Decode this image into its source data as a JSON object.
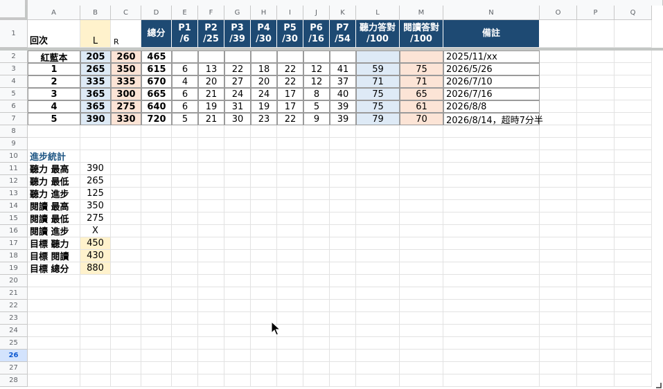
{
  "columns": [
    "A",
    "B",
    "C",
    "D",
    "E",
    "F",
    "G",
    "H",
    "I",
    "J",
    "K",
    "L",
    "M",
    "N",
    "O",
    "P",
    "Q"
  ],
  "rows": [
    "1",
    "2",
    "3",
    "4",
    "5",
    "6",
    "7",
    "8",
    "9",
    "10",
    "11",
    "12",
    "13",
    "14",
    "15",
    "16",
    "17",
    "18",
    "19",
    "20",
    "21",
    "22",
    "23",
    "24",
    "25",
    "26",
    "27",
    "28"
  ],
  "selected_row": "26",
  "header": {
    "round": "回次",
    "l": "L",
    "r": "R",
    "total": "總分",
    "parts": [
      "P1\n/6",
      "P2\n/25",
      "P3\n/39",
      "P4\n/30",
      "P5\n/30",
      "P6\n/16",
      "P7\n/54"
    ],
    "listening_correct": "聽力答對\n/100",
    "reading_correct": "閱讀答對\n/100",
    "notes": "備註"
  },
  "scores": [
    {
      "round": "紅藍本",
      "l": "205",
      "r": "260",
      "total": "465",
      "parts": [
        "",
        "",
        "",
        "",
        "",
        "",
        ""
      ],
      "lc": "",
      "rc": "",
      "note": "2025/11/xx"
    },
    {
      "round": "1",
      "l": "265",
      "r": "350",
      "total": "615",
      "parts": [
        "6",
        "13",
        "22",
        "18",
        "22",
        "12",
        "41"
      ],
      "lc": "59",
      "rc": "75",
      "note": "2026/5/26"
    },
    {
      "round": "2",
      "l": "335",
      "r": "335",
      "total": "670",
      "parts": [
        "4",
        "20",
        "27",
        "20",
        "22",
        "12",
        "37"
      ],
      "lc": "71",
      "rc": "71",
      "note": "2026/7/10"
    },
    {
      "round": "3",
      "l": "365",
      "r": "300",
      "total": "665",
      "parts": [
        "6",
        "21",
        "24",
        "24",
        "17",
        "8",
        "40"
      ],
      "lc": "75",
      "rc": "65",
      "note": "2026/7/16"
    },
    {
      "round": "4",
      "l": "365",
      "r": "275",
      "total": "640",
      "parts": [
        "6",
        "19",
        "31",
        "19",
        "17",
        "5",
        "39"
      ],
      "lc": "75",
      "rc": "61",
      "note": "2026/8/8"
    },
    {
      "round": "5",
      "l": "390",
      "r": "330",
      "total": "720",
      "parts": [
        "5",
        "21",
        "30",
        "23",
        "22",
        "9",
        "39"
      ],
      "lc": "79",
      "rc": "70",
      "note": "2026/8/14，超時7分半"
    }
  ],
  "progress": {
    "title": "進步統計",
    "items": [
      {
        "label": "聽力 最高",
        "value": "390",
        "target": false
      },
      {
        "label": "聽力 最低",
        "value": "265",
        "target": false
      },
      {
        "label": "聽力 進步",
        "value": "125",
        "target": false
      },
      {
        "label": "閱讀 最高",
        "value": "350",
        "target": false
      },
      {
        "label": "閱讀 最低",
        "value": "275",
        "target": false
      },
      {
        "label": "閱讀 進步",
        "value": "X",
        "target": false
      },
      {
        "label": "目標 聽力",
        "value": "450",
        "target": true
      },
      {
        "label": "目標 閱讀",
        "value": "430",
        "target": true
      },
      {
        "label": "目標 總分",
        "value": "880",
        "target": true
      }
    ]
  },
  "colors": {
    "header_blue": "#1e4a73",
    "listen_blue": "#deeaf6",
    "read_pink": "#fce4d6",
    "target_yellow": "#fff2cc",
    "section_title": "#1f5684"
  }
}
